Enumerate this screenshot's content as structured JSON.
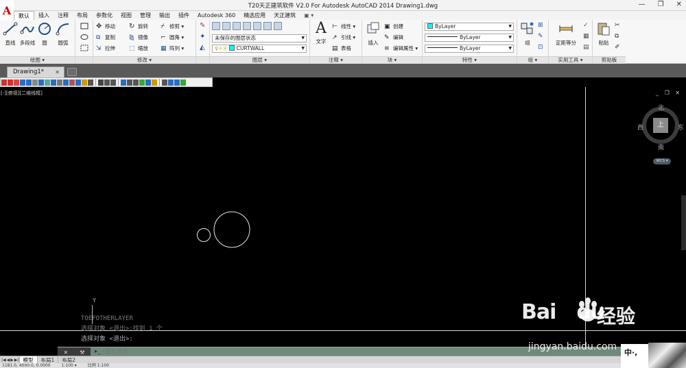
{
  "window": {
    "title": "T20天正建筑软件 V2.0 For Autodesk AutoCAD 2014    Drawing1.dwg",
    "logo": "A",
    "controls": [
      "—",
      "❐",
      "✕"
    ]
  },
  "menu_tabs": [
    "默认",
    "插入",
    "注释",
    "布局",
    "参数化",
    "视图",
    "管理",
    "输出",
    "插件",
    "Autodesk 360",
    "精选应用",
    "天正建筑",
    "▣ ▾"
  ],
  "ribbon": {
    "draw": {
      "title": "绘图 ▾",
      "line": "直线",
      "polyline": "多段线",
      "circle": "圆",
      "arc": "圆弧"
    },
    "modify": {
      "title": "修改 ▾",
      "move": "移动",
      "rotate": "旋转",
      "trim": "修剪 ▾",
      "copy": "复制",
      "mirror": "镜像",
      "fillet": "圆角 ▾",
      "stretch": "拉伸",
      "scale": "缩放",
      "array": "阵列 ▾"
    },
    "layers": {
      "title": "图层 ▾",
      "layer_state": "未保存的图层状态",
      "current_layer": "CURTWALL",
      "layer_color": "#00ffff"
    },
    "annotation": {
      "title": "注释 ▾",
      "text": "文字",
      "linear": "线性 ▾",
      "leader": "引线 ▾",
      "table": "表格"
    },
    "block": {
      "title": "块 ▾",
      "insert": "插入",
      "create": "创建",
      "edit": "编辑",
      "edit_attr": "编辑属性 ▾"
    },
    "properties": {
      "title": "特性 ▾",
      "color": "ByLayer",
      "color_swatch": "#00ffff",
      "linetype": "ByLayer",
      "lineweight": "ByLayer"
    },
    "group": {
      "title": "组 ▾",
      "group": "组"
    },
    "utilities": {
      "title": "实用工具 ▾",
      "measure": "定距等分"
    },
    "clipboard": {
      "title": "剪贴板",
      "paste": "粘贴"
    }
  },
  "file_tab": {
    "name": "Drawing1*",
    "close": "✕"
  },
  "viewport_label": "[-][俯视][二维线框]",
  "viewport_controls": "_ ❐ ✕",
  "viewcube": {
    "north": "北",
    "south": "南",
    "east": "东",
    "west": "西",
    "face": "上",
    "wcs": "WCS ▾"
  },
  "ucs": {
    "y": "Y"
  },
  "command_history": [
    "TOEFOTHERLAYER",
    "选择对象 <退出>:找到 1 个",
    "选择对象 <退出>:"
  ],
  "command_line": {
    "prompt_icon": "▸_",
    "placeholder": "键入命令",
    "buttons": [
      "✕",
      "🔧"
    ]
  },
  "layout_tabs": [
    "模型",
    "布局1",
    "布局2"
  ],
  "status_bar": [
    "1181.0, 4000.0, 0.0000",
    "1:100 ▾",
    "比例 1:100"
  ],
  "watermark": {
    "brand": "Bai",
    "brand_end": "du",
    "cn": "经验",
    "url": "jingyan.baidu.com"
  },
  "ime": "中·,"
}
